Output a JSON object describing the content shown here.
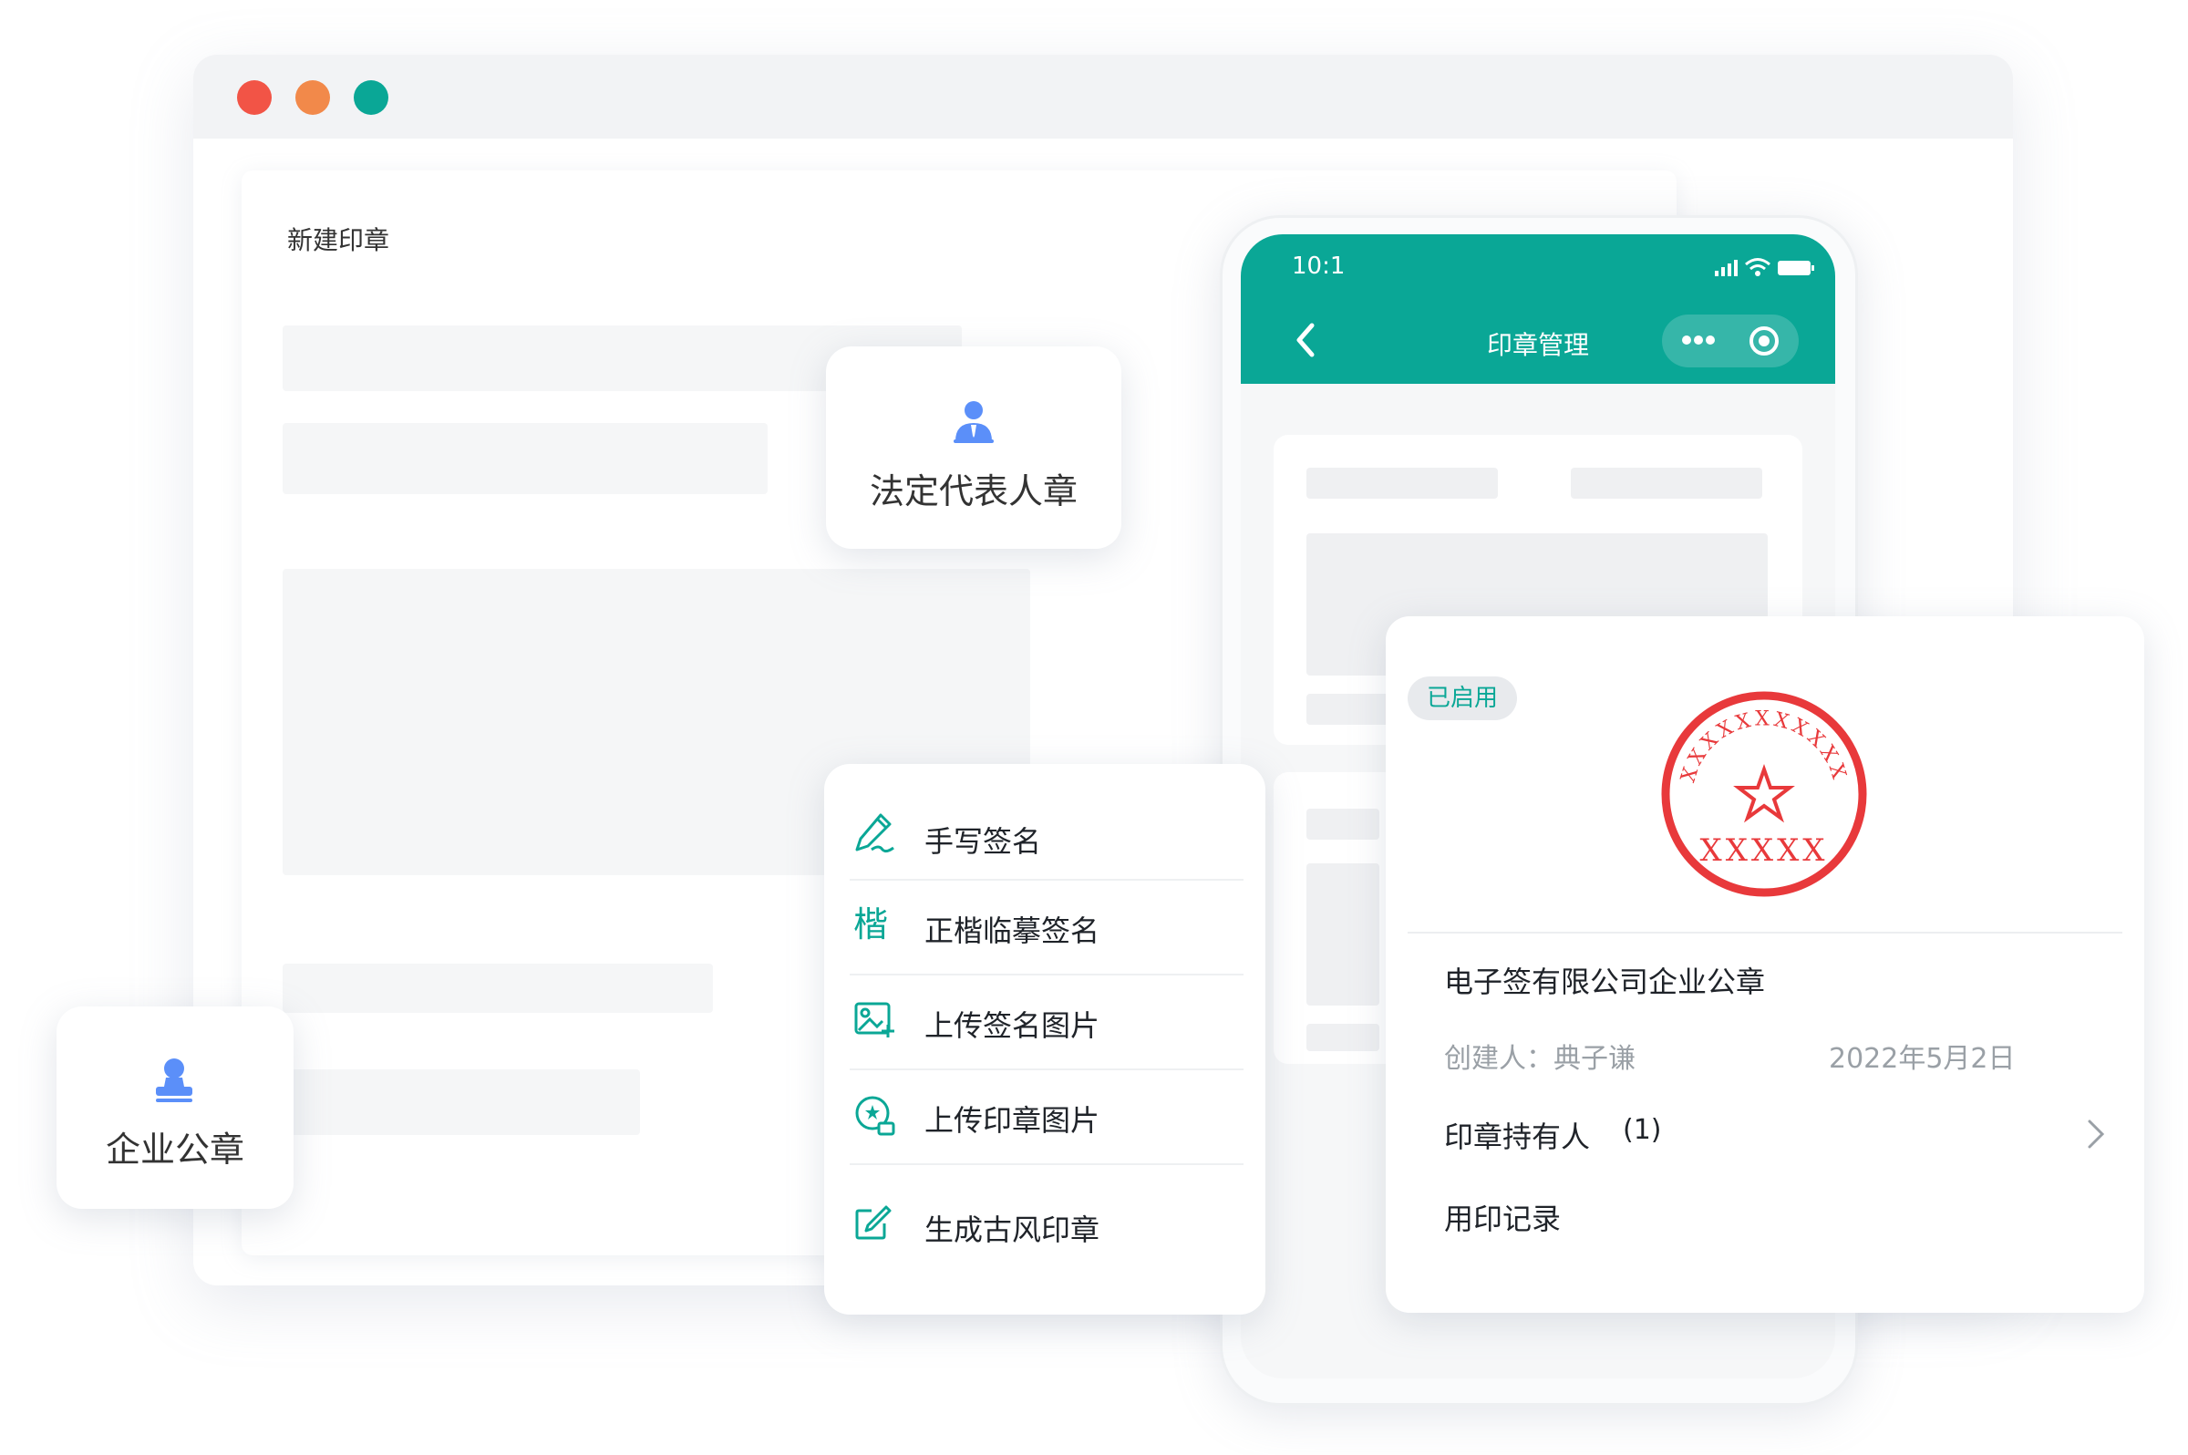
{
  "browser": {
    "dots": [
      {
        "name": "close",
        "color": "#f25446"
      },
      {
        "name": "minimize",
        "color": "#f2894a"
      },
      {
        "name": "maximize",
        "color": "#0aa796"
      }
    ]
  },
  "form": {
    "title": "新建印章"
  },
  "legal_rep_card": {
    "label": "法定代表人章",
    "icon": "user-icon",
    "icon_color": "#5b8ff9"
  },
  "company_card": {
    "label": "企业公章",
    "icon": "stamp-icon",
    "icon_color": "#5b8ff9"
  },
  "phone": {
    "time": "10:1",
    "title": "印章管理",
    "accent": "#0aa796"
  },
  "menu": {
    "items": [
      {
        "label": "手写签名",
        "icon": "pen-icon"
      },
      {
        "label": "正楷临摹签名",
        "icon": "kai-icon",
        "icon_text": "楷"
      },
      {
        "label": "上传签名图片",
        "icon": "image-upload-icon"
      },
      {
        "label": "上传印章图片",
        "icon": "seal-upload-icon"
      },
      {
        "label": "生成古风印章",
        "icon": "edit-square-icon"
      }
    ]
  },
  "seal_detail": {
    "status": "已启用",
    "seal_text": "XXXXX",
    "seal_arc": "XXXXXXXXXXX",
    "seal_color": "#e8393b",
    "name": "电子签有限公司企业公章",
    "creator_label": "创建人：",
    "creator": "典子谦",
    "date": "2022年5月2日",
    "holder_label": "印章持有人",
    "holder_count": "(1)",
    "records_label": "用印记录"
  }
}
